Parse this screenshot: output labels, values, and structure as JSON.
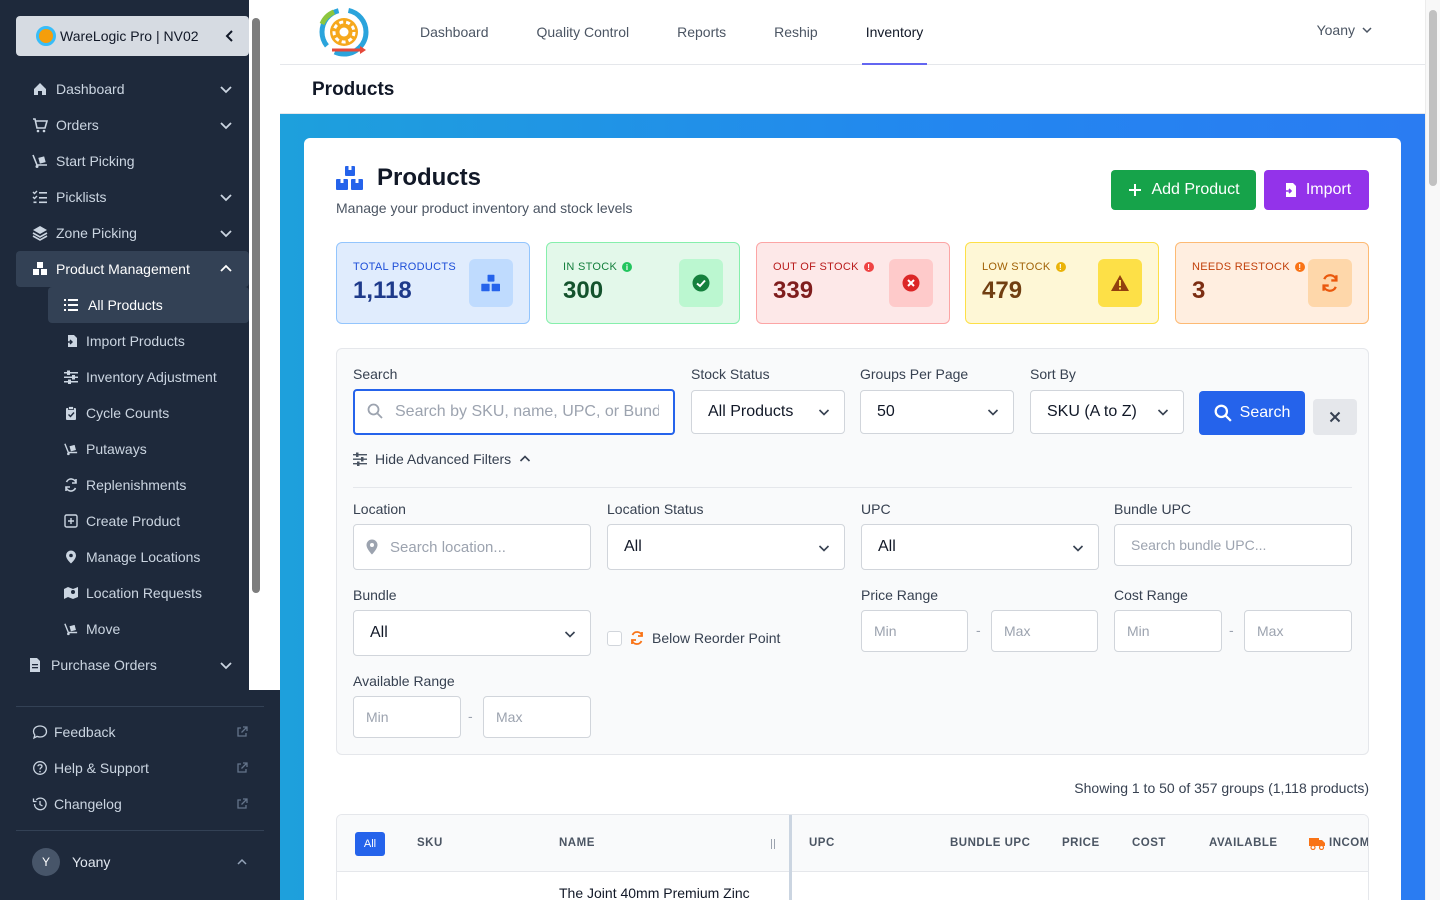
{
  "workspace": {
    "label": "WareLogic Pro | NV02"
  },
  "sidebar": {
    "nav": [
      {
        "label": "Dashboard",
        "icon": "home-icon",
        "expandable": true
      },
      {
        "label": "Orders",
        "icon": "cart-icon",
        "expandable": true
      },
      {
        "label": "Start Picking",
        "icon": "dolly-icon",
        "expandable": false
      },
      {
        "label": "Picklists",
        "icon": "list-check-icon",
        "expandable": true
      },
      {
        "label": "Zone Picking",
        "icon": "layers-icon",
        "expandable": true
      },
      {
        "label": "Product Management",
        "icon": "boxes-icon",
        "expanded": true
      }
    ],
    "sub": [
      {
        "label": "All Products",
        "icon": "list-icon",
        "active": true
      },
      {
        "label": "Import Products",
        "icon": "file-import-icon"
      },
      {
        "label": "Inventory Adjustment",
        "icon": "sliders-icon"
      },
      {
        "label": "Cycle Counts",
        "icon": "clipboard-icon"
      },
      {
        "label": "Putaways",
        "icon": "dolly-icon"
      },
      {
        "label": "Replenishments",
        "icon": "refresh-icon"
      },
      {
        "label": "Create Product",
        "icon": "plus-square-icon"
      },
      {
        "label": "Manage Locations",
        "icon": "map-pin-icon"
      },
      {
        "label": "Location Requests",
        "icon": "map-request-icon"
      },
      {
        "label": "Move",
        "icon": "dolly-icon"
      }
    ],
    "purchase_orders": "Purchase Orders",
    "links": [
      {
        "label": "Feedback",
        "icon": "chat-icon"
      },
      {
        "label": "Help & Support",
        "icon": "help-icon"
      },
      {
        "label": "Changelog",
        "icon": "history-icon"
      }
    ],
    "user": {
      "initial": "Y",
      "name": "Yoany"
    }
  },
  "topnav": {
    "tabs": [
      "Dashboard",
      "Quality Control",
      "Reports",
      "Reship",
      "Inventory"
    ],
    "active": "Inventory",
    "user": "Yoany"
  },
  "page": {
    "title": "Products"
  },
  "card": {
    "title": "Products",
    "subtitle": "Manage your product inventory and stock levels",
    "add_label": "Add Product",
    "import_label": "Import"
  },
  "stats": [
    {
      "label": "TOTAL PRODUCTS",
      "value": "1,118",
      "color": "#1d4ed8",
      "bg": "#e0ecfd",
      "border": "#93c5fd",
      "icon": "boxes-icon"
    },
    {
      "label": "IN STOCK",
      "value": "300",
      "color": "#15803d",
      "bg": "#e3f8ea",
      "border": "#86efac",
      "icon": "check-circle-icon"
    },
    {
      "label": "OUT OF STOCK",
      "value": "339",
      "color": "#b91c1c",
      "bg": "#fde8e8",
      "border": "#fca5a5",
      "icon": "x-circle-icon"
    },
    {
      "label": "LOW STOCK",
      "value": "479",
      "color": "#a16207",
      "bg": "#fef7d6",
      "border": "#fde047",
      "icon": "warning-icon"
    },
    {
      "label": "NEEDS RESTOCK",
      "value": "3",
      "color": "#c2410c",
      "bg": "#ffeee0",
      "border": "#fdba74",
      "icon": "refresh-icon"
    }
  ],
  "filters": {
    "search_label": "Search",
    "search_placeholder": "Search by SKU, name, UPC, or Bundle UPC",
    "stock_status_label": "Stock Status",
    "stock_status_value": "All Products",
    "groups_label": "Groups Per Page",
    "groups_value": "50",
    "sort_label": "Sort By",
    "sort_value": "SKU (A to Z)",
    "search_button": "Search",
    "advanced_toggle": "Hide Advanced Filters",
    "location_label": "Location",
    "location_placeholder": "Search location...",
    "location_status_label": "Location Status",
    "location_status_value": "All",
    "upc_label": "UPC",
    "upc_value": "All",
    "bundle_upc_label": "Bundle UPC",
    "bundle_upc_placeholder": "Search bundle UPC...",
    "bundle_label": "Bundle",
    "bundle_value": "All",
    "below_reorder_label": "Below Reorder Point",
    "price_range_label": "Price Range",
    "cost_range_label": "Cost Range",
    "available_range_label": "Available Range",
    "min_placeholder": "Min",
    "max_placeholder": "Max",
    "dash": "-"
  },
  "results": {
    "showing": "Showing 1 to 50 of 357 groups (1,118 products)"
  },
  "table": {
    "all_pill": "All",
    "headers": [
      "SKU",
      "NAME",
      "UPC",
      "BUNDLE UPC",
      "PRICE",
      "COST",
      "AVAILABLE",
      "INCOMING"
    ],
    "first_row_name": "The Joint 40mm Premium Zinc"
  }
}
